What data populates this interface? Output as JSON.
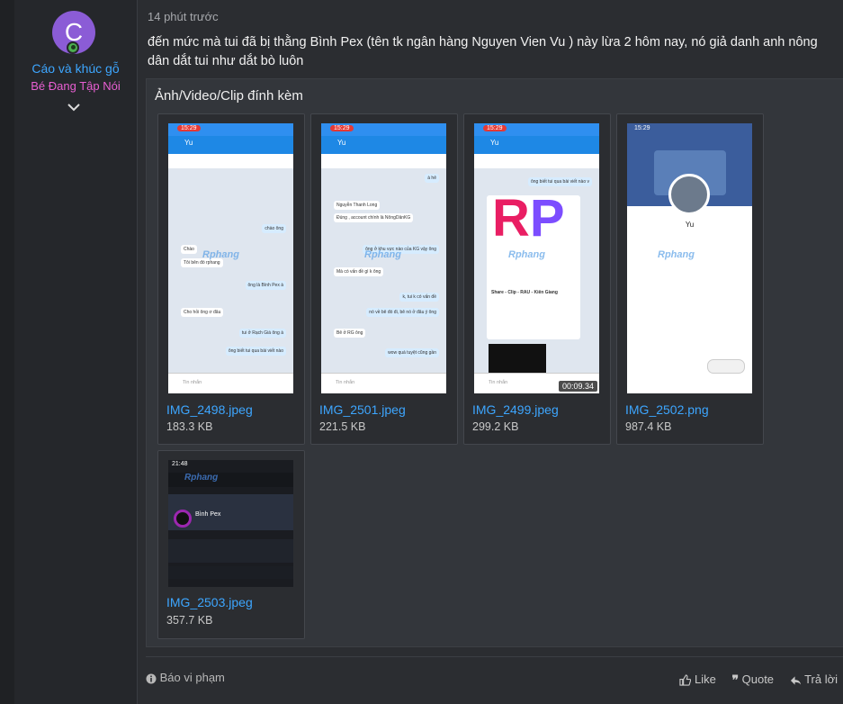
{
  "user": {
    "avatar_letter": "C",
    "name": "Cáo và khúc gỗ",
    "title": "Bé Đang Tập Nói"
  },
  "post": {
    "time": "14 phút trước",
    "message": "đến mức mà tui đã bị thằng Bình Pex (tên tk ngân hàng Nguyen Vien Vu ) này lừa 2 hôm nay, nó giả danh anh nông dân dắt tui như dắt bò luôn"
  },
  "attachments": {
    "heading": "Ảnh/Video/Clip đính kèm",
    "items": [
      {
        "name": "IMG_2498.jpeg",
        "size": "183.3 KB"
      },
      {
        "name": "IMG_2501.jpeg",
        "size": "221.5 KB"
      },
      {
        "name": "IMG_2499.jpeg",
        "size": "299.2 KB",
        "duration": "00:09.34"
      },
      {
        "name": "IMG_2502.png",
        "size": "987.4 KB"
      },
      {
        "name": "IMG_2503.jpeg",
        "size": "357.7 KB"
      }
    ]
  },
  "thumbs": {
    "status_time": "15:29",
    "chat_name": "Yu",
    "watermark": "Rphang",
    "input_placeholder": "Tin nhắn",
    "bubbles_1": [
      "chào ông",
      "Chào",
      "Tôi bên đó rphang",
      "ông là Bình Pex à",
      "Cho hỏi ông ơ đâu",
      "tui ở Rạch Giá ông à",
      "ông biết tui qua bài viết nào"
    ],
    "bubbles_2": [
      "à hê",
      "Nguyễn Thanh Long",
      "Đúng , account chính là NôngDânKG",
      "ông ở khu vực nào của KG vậy ông",
      "Mà có vấn đề gì k ông",
      "k, tui k có vấn đề",
      "nó về bê đó đi, bê nó ở đâu ý ông",
      "Bê ở RG ông",
      "wow quá tuyệt cũng gần"
    ],
    "bubbles_3": [
      "ông biết tui qua bài viết nào v",
      "Share - Clip - RAU - Kiên Giang"
    ],
    "rp_text": "RP",
    "profile_name": "Yu",
    "profile_time": "15:29",
    "forum_time": "21:48",
    "forum_user": "Bình Pex"
  },
  "footer": {
    "report": "Báo vi phạm",
    "like": "Like",
    "quote": "Quote",
    "reply": "Trả lời"
  }
}
